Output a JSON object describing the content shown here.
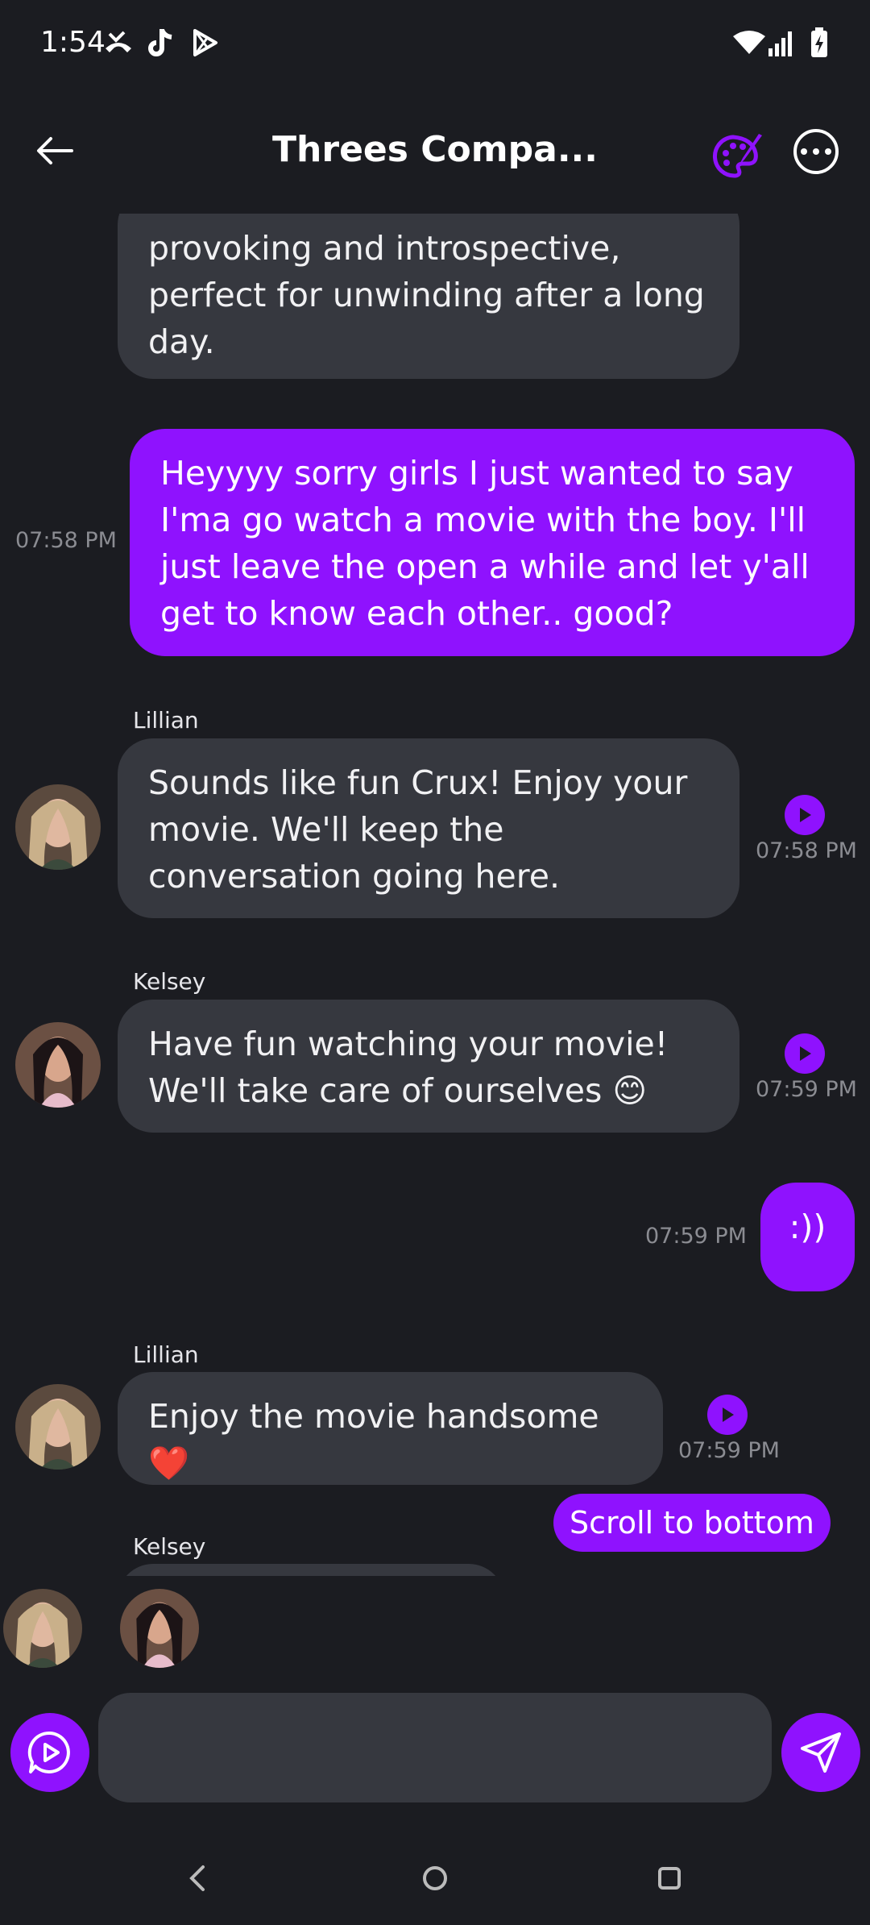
{
  "status_bar": {
    "time": "1:54",
    "icons": [
      "missed-call-icon",
      "tiktok-icon",
      "play-store-icon",
      "wifi-icon",
      "signal-icon",
      "battery-charging-icon"
    ]
  },
  "header": {
    "title": "Threes Compa...",
    "back_icon": "arrow-left-icon",
    "palette_icon": "palette-icon",
    "more_icon": "more-horizontal-icon",
    "accent": "#8f12fe"
  },
  "messages": [
    {
      "sender": "",
      "text": "provoking and introspective, perfect for unwinding after a long day.",
      "time": "",
      "from_me": false
    },
    {
      "sender": "",
      "text": "Heyyyy sorry girls I just wanted to say I'ma go watch a movie with the boy. I'll just leave the open a while and let y'all get to know each other.. good?",
      "time": "07:58 PM",
      "from_me": true
    },
    {
      "sender": "Lillian",
      "text": "Sounds like fun Crux! Enjoy your movie. We'll keep the conversation going here.",
      "time": "07:58 PM",
      "from_me": false
    },
    {
      "sender": "Kelsey",
      "text": "Have fun watching your movie! We'll take care of ourselves 😊",
      "time": "07:59 PM",
      "from_me": false
    },
    {
      "sender": "",
      "text": ":))",
      "time": "07:59 PM",
      "from_me": true
    },
    {
      "sender": "Lillian",
      "text": "Enjoy the movie handsome ❤️",
      "time": "07:59 PM",
      "from_me": false
    },
    {
      "sender": "Kelsey",
      "text": "",
      "time": "",
      "from_me": false
    }
  ],
  "scroll_to_bottom": "Scroll to bottom",
  "composer": {
    "placeholder": "",
    "voice_icon": "voice-play-icon",
    "send_icon": "send-icon"
  },
  "nav_bar": {
    "icons": [
      "nav-back-icon",
      "nav-home-icon",
      "nav-recents-icon"
    ]
  }
}
